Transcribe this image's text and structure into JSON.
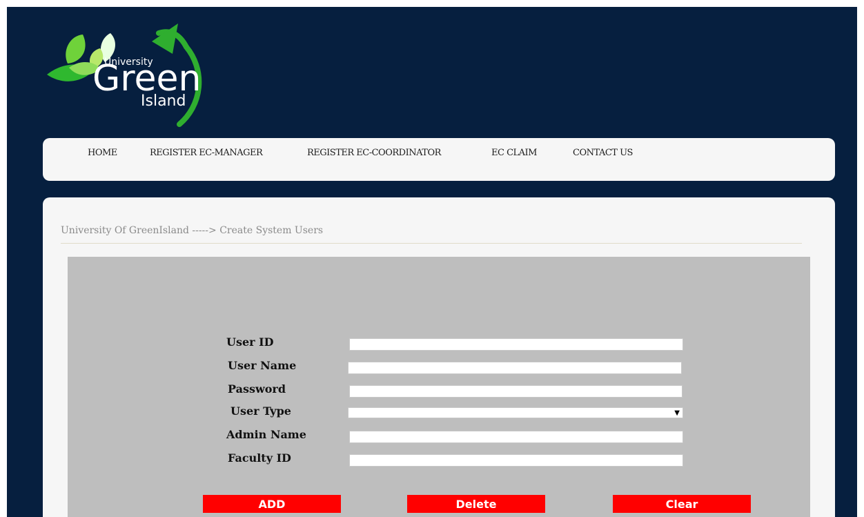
{
  "logo": {
    "top_word": "University",
    "main_word": "Green",
    "sub_word": "Island"
  },
  "nav": {
    "items": [
      {
        "label": "HOME"
      },
      {
        "label": "REGISTER EC-MANAGER"
      },
      {
        "label": "REGISTER EC-COORDINATOR"
      },
      {
        "label": "EC CLAIM"
      },
      {
        "label": "CONTACT US"
      }
    ]
  },
  "breadcrumb": "University Of GreenIsland -----> Create System Users",
  "form": {
    "user_id_label": "User ID",
    "user_name_label": "User Name",
    "password_label": "Password",
    "user_type_label": "User Type",
    "admin_name_label": "Admin Name",
    "faculty_id_label": "Faculty ID",
    "user_id_value": "",
    "user_name_value": "",
    "password_value": "",
    "user_type_value": "",
    "admin_name_value": "",
    "faculty_id_value": ""
  },
  "buttons": {
    "add": "ADD",
    "delete": "Delete",
    "clear": "Clear"
  },
  "colors": {
    "page_bg": "#061f3f",
    "panel_bg": "#bebebe",
    "button_red": "#ff0000",
    "leaf_green": "#3cc43c"
  }
}
